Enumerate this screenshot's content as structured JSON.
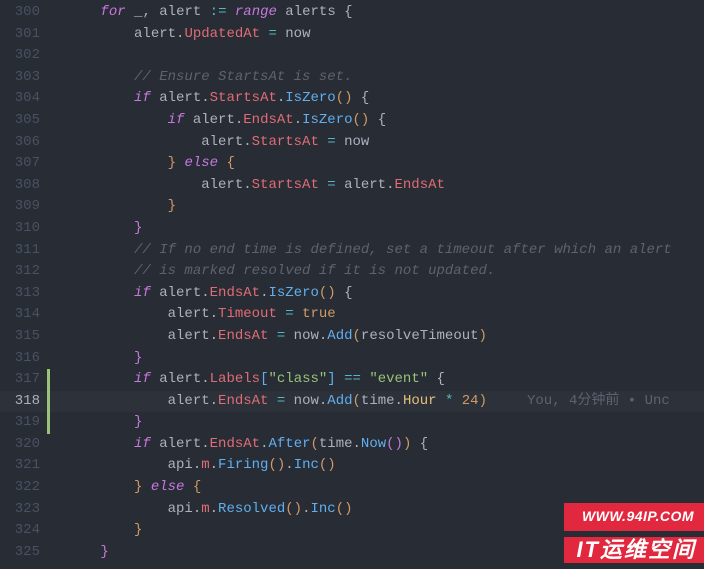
{
  "gutter": {
    "start": 300,
    "end": 325,
    "active": 318
  },
  "git_add": {
    "start": 317,
    "end": 319
  },
  "blame": {
    "author": "You",
    "when": "4分钟前",
    "sep": " • ",
    "tail": "Unc"
  },
  "code": {
    "l300": [
      {
        "t": "      ",
        "c": "p"
      },
      {
        "t": "for",
        "c": "kw"
      },
      {
        "t": " _",
        "c": "id"
      },
      {
        "t": ",",
        "c": "p"
      },
      {
        "t": " alert ",
        "c": "id"
      },
      {
        "t": ":=",
        "c": "op"
      },
      {
        "t": " ",
        "c": "p"
      },
      {
        "t": "range",
        "c": "kw"
      },
      {
        "t": " alerts ",
        "c": "id"
      },
      {
        "t": "{",
        "c": "p"
      }
    ],
    "l301": [
      {
        "t": "          alert",
        "c": "id"
      },
      {
        "t": ".",
        "c": "p"
      },
      {
        "t": "UpdatedAt",
        "c": "prop"
      },
      {
        "t": " ",
        "c": "p"
      },
      {
        "t": "=",
        "c": "op"
      },
      {
        "t": " now",
        "c": "id"
      }
    ],
    "l302": [],
    "l303": [
      {
        "t": "          ",
        "c": "p"
      },
      {
        "t": "// Ensure StartsAt is set.",
        "c": "cmt"
      }
    ],
    "l304": [
      {
        "t": "          ",
        "c": "p"
      },
      {
        "t": "if",
        "c": "kw"
      },
      {
        "t": " alert",
        "c": "id"
      },
      {
        "t": ".",
        "c": "p"
      },
      {
        "t": "StartsAt",
        "c": "prop"
      },
      {
        "t": ".",
        "c": "p"
      },
      {
        "t": "IsZero",
        "c": "fn"
      },
      {
        "t": "()",
        "c": "br-y"
      },
      {
        "t": " ",
        "c": "p"
      },
      {
        "t": "{",
        "c": "p"
      }
    ],
    "l305": [
      {
        "t": "              ",
        "c": "p"
      },
      {
        "t": "if",
        "c": "kw"
      },
      {
        "t": " alert",
        "c": "id"
      },
      {
        "t": ".",
        "c": "p"
      },
      {
        "t": "EndsAt",
        "c": "prop"
      },
      {
        "t": ".",
        "c": "p"
      },
      {
        "t": "IsZero",
        "c": "fn"
      },
      {
        "t": "()",
        "c": "br-y"
      },
      {
        "t": " ",
        "c": "p"
      },
      {
        "t": "{",
        "c": "p"
      }
    ],
    "l306": [
      {
        "t": "                  alert",
        "c": "id"
      },
      {
        "t": ".",
        "c": "p"
      },
      {
        "t": "StartsAt",
        "c": "prop"
      },
      {
        "t": " ",
        "c": "p"
      },
      {
        "t": "=",
        "c": "op"
      },
      {
        "t": " now",
        "c": "id"
      }
    ],
    "l307": [
      {
        "t": "              ",
        "c": "p"
      },
      {
        "t": "}",
        "c": "br-y"
      },
      {
        "t": " ",
        "c": "p"
      },
      {
        "t": "else",
        "c": "kw"
      },
      {
        "t": " ",
        "c": "p"
      },
      {
        "t": "{",
        "c": "br-y"
      }
    ],
    "l308": [
      {
        "t": "                  alert",
        "c": "id"
      },
      {
        "t": ".",
        "c": "p"
      },
      {
        "t": "StartsAt",
        "c": "prop"
      },
      {
        "t": " ",
        "c": "p"
      },
      {
        "t": "=",
        "c": "op"
      },
      {
        "t": " alert",
        "c": "id"
      },
      {
        "t": ".",
        "c": "p"
      },
      {
        "t": "EndsAt",
        "c": "prop"
      }
    ],
    "l309": [
      {
        "t": "              ",
        "c": "p"
      },
      {
        "t": "}",
        "c": "br-y"
      }
    ],
    "l310": [
      {
        "t": "          ",
        "c": "p"
      },
      {
        "t": "}",
        "c": "br-p"
      }
    ],
    "l311": [
      {
        "t": "          ",
        "c": "p"
      },
      {
        "t": "// If no end time is defined, set a timeout after which an alert",
        "c": "cmt"
      }
    ],
    "l312": [
      {
        "t": "          ",
        "c": "p"
      },
      {
        "t": "// is marked resolved if it is not updated.",
        "c": "cmt"
      }
    ],
    "l313": [
      {
        "t": "          ",
        "c": "p"
      },
      {
        "t": "if",
        "c": "kw"
      },
      {
        "t": " alert",
        "c": "id"
      },
      {
        "t": ".",
        "c": "p"
      },
      {
        "t": "EndsAt",
        "c": "prop"
      },
      {
        "t": ".",
        "c": "p"
      },
      {
        "t": "IsZero",
        "c": "fn"
      },
      {
        "t": "()",
        "c": "br-y"
      },
      {
        "t": " ",
        "c": "p"
      },
      {
        "t": "{",
        "c": "p"
      }
    ],
    "l314": [
      {
        "t": "              alert",
        "c": "id"
      },
      {
        "t": ".",
        "c": "p"
      },
      {
        "t": "Timeout",
        "c": "prop"
      },
      {
        "t": " ",
        "c": "p"
      },
      {
        "t": "=",
        "c": "op"
      },
      {
        "t": " ",
        "c": "p"
      },
      {
        "t": "true",
        "c": "bool"
      }
    ],
    "l315": [
      {
        "t": "              alert",
        "c": "id"
      },
      {
        "t": ".",
        "c": "p"
      },
      {
        "t": "EndsAt",
        "c": "prop"
      },
      {
        "t": " ",
        "c": "p"
      },
      {
        "t": "=",
        "c": "op"
      },
      {
        "t": " now",
        "c": "id"
      },
      {
        "t": ".",
        "c": "p"
      },
      {
        "t": "Add",
        "c": "fn"
      },
      {
        "t": "(",
        "c": "br-y"
      },
      {
        "t": "resolveTimeout",
        "c": "id"
      },
      {
        "t": ")",
        "c": "br-y"
      }
    ],
    "l316": [
      {
        "t": "          ",
        "c": "p"
      },
      {
        "t": "}",
        "c": "br-p"
      }
    ],
    "l317": [],
    "l318": [
      {
        "t": "          ",
        "c": "p"
      },
      {
        "t": "if",
        "c": "kw"
      },
      {
        "t": " alert",
        "c": "id"
      },
      {
        "t": ".",
        "c": "p"
      },
      {
        "t": "Labels",
        "c": "prop"
      },
      {
        "t": "[",
        "c": "br-b"
      },
      {
        "t": "\"class\"",
        "c": "str"
      },
      {
        "t": "]",
        "c": "br-b"
      },
      {
        "t": " ",
        "c": "p"
      },
      {
        "t": "==",
        "c": "op"
      },
      {
        "t": " ",
        "c": "p"
      },
      {
        "t": "\"event\"",
        "c": "str"
      },
      {
        "t": " ",
        "c": "p"
      },
      {
        "t": "{",
        "c": "p"
      }
    ],
    "l319": [
      {
        "t": "              alert",
        "c": "id"
      },
      {
        "t": ".",
        "c": "p"
      },
      {
        "t": "EndsAt",
        "c": "prop"
      },
      {
        "t": " ",
        "c": "p"
      },
      {
        "t": "=",
        "c": "op"
      },
      {
        "t": " now",
        "c": "id"
      },
      {
        "t": ".",
        "c": "p"
      },
      {
        "t": "Add",
        "c": "fn"
      },
      {
        "t": "(",
        "c": "br-y"
      },
      {
        "t": "time",
        "c": "id"
      },
      {
        "t": ".",
        "c": "p"
      },
      {
        "t": "Hour",
        "c": "type"
      },
      {
        "t": " ",
        "c": "p"
      },
      {
        "t": "*",
        "c": "op"
      },
      {
        "t": " ",
        "c": "p"
      },
      {
        "t": "24",
        "c": "num"
      },
      {
        "t": ")",
        "c": "br-y"
      }
    ],
    "l320": [
      {
        "t": "          ",
        "c": "p"
      },
      {
        "t": "}",
        "c": "br-p"
      }
    ],
    "l321": [
      {
        "t": "          ",
        "c": "p"
      },
      {
        "t": "if",
        "c": "kw"
      },
      {
        "t": " alert",
        "c": "id"
      },
      {
        "t": ".",
        "c": "p"
      },
      {
        "t": "EndsAt",
        "c": "prop"
      },
      {
        "t": ".",
        "c": "p"
      },
      {
        "t": "After",
        "c": "fn"
      },
      {
        "t": "(",
        "c": "br-y"
      },
      {
        "t": "time",
        "c": "id"
      },
      {
        "t": ".",
        "c": "p"
      },
      {
        "t": "Now",
        "c": "fn"
      },
      {
        "t": "()",
        "c": "br-p"
      },
      {
        "t": ")",
        "c": "br-y"
      },
      {
        "t": " ",
        "c": "p"
      },
      {
        "t": "{",
        "c": "p"
      }
    ],
    "l322": [
      {
        "t": "              api",
        "c": "id"
      },
      {
        "t": ".",
        "c": "p"
      },
      {
        "t": "m",
        "c": "prop"
      },
      {
        "t": ".",
        "c": "p"
      },
      {
        "t": "Firing",
        "c": "fn"
      },
      {
        "t": "()",
        "c": "br-y"
      },
      {
        "t": ".",
        "c": "p"
      },
      {
        "t": "Inc",
        "c": "fn"
      },
      {
        "t": "()",
        "c": "br-y"
      }
    ],
    "l323": [
      {
        "t": "          ",
        "c": "p"
      },
      {
        "t": "}",
        "c": "br-y"
      },
      {
        "t": " ",
        "c": "p"
      },
      {
        "t": "else",
        "c": "kw"
      },
      {
        "t": " ",
        "c": "p"
      },
      {
        "t": "{",
        "c": "br-y"
      }
    ],
    "l324": [
      {
        "t": "              api",
        "c": "id"
      },
      {
        "t": ".",
        "c": "p"
      },
      {
        "t": "m",
        "c": "prop"
      },
      {
        "t": ".",
        "c": "p"
      },
      {
        "t": "Resolved",
        "c": "fn"
      },
      {
        "t": "()",
        "c": "br-y"
      },
      {
        "t": ".",
        "c": "p"
      },
      {
        "t": "Inc",
        "c": "fn"
      },
      {
        "t": "()",
        "c": "br-y"
      }
    ],
    "l325": [
      {
        "t": "          ",
        "c": "p"
      },
      {
        "t": "}",
        "c": "br-y"
      }
    ],
    "l326": [
      {
        "t": "      ",
        "c": "p"
      },
      {
        "t": "}",
        "c": "br-p"
      }
    ]
  },
  "watermark": {
    "url": "WWW.94IP.COM",
    "label": "IT运维空间"
  }
}
